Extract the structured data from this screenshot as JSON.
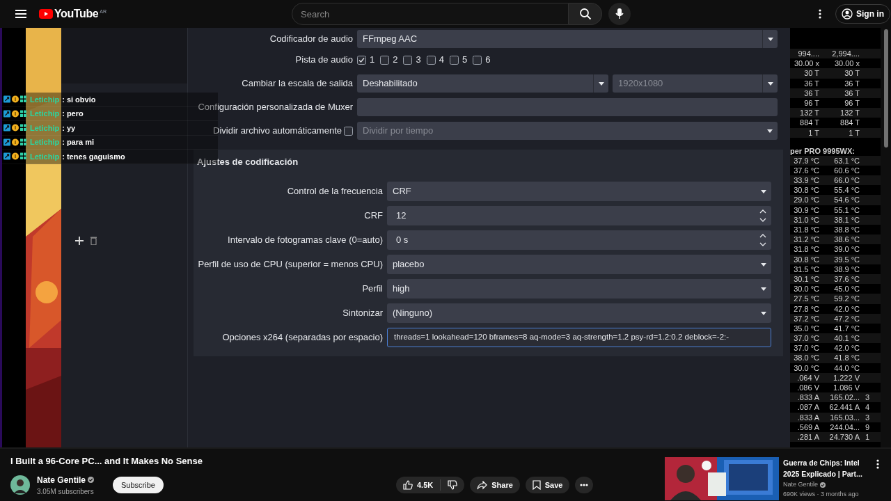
{
  "youtube": {
    "logo": "YouTube",
    "region": "AR",
    "search": {
      "placeholder": "Search"
    },
    "sign_in": "Sign in"
  },
  "video": {
    "chat": [
      {
        "user": "Letichip",
        "message": ": si obvio"
      },
      {
        "user": "Letichip",
        "message": ": pero"
      },
      {
        "user": "Letichip",
        "message": ": yy"
      },
      {
        "user": "Letichip",
        "message": ": para mi"
      },
      {
        "user": "Letichip",
        "message": ": tenes gaguismo"
      }
    ],
    "output_settings": [
      {
        "kind": "select",
        "label": "Codificador de audio",
        "value": "FFmpeg AAC"
      },
      {
        "kind": "tracks",
        "label": "Pista de audio",
        "tracks": [
          {
            "label": "1",
            "checked": true
          },
          {
            "label": "2",
            "checked": false
          },
          {
            "label": "3",
            "checked": false
          },
          {
            "label": "4",
            "checked": false
          },
          {
            "label": "5",
            "checked": false
          },
          {
            "label": "6",
            "checked": false
          }
        ]
      },
      {
        "kind": "dual_select",
        "label": "Cambiar la escala de salida",
        "value": "Deshabilitado",
        "value_2": "1920x1080",
        "disabled_2": true
      },
      {
        "kind": "text",
        "label": "Configuración personalizada de Muxer"
      },
      {
        "kind": "check_select",
        "label": "Dividir archivo automáticamente",
        "checked": false,
        "value": "Dividir por tiempo",
        "disabled": true
      }
    ],
    "encoding": {
      "title": "Ajustes de codificación",
      "rows": [
        {
          "kind": "select",
          "label": "Control de la frecuencia",
          "value": "CRF"
        },
        {
          "kind": "spin",
          "label": "CRF",
          "value": "12"
        },
        {
          "kind": "spin",
          "label": "Intervalo de fotogramas clave (0=auto)",
          "value": "0 s"
        },
        {
          "kind": "select",
          "label": "Perfil de uso de CPU (superior = menos CPU)",
          "value": "placebo"
        },
        {
          "kind": "select",
          "label": "Perfil",
          "value": "high"
        },
        {
          "kind": "select",
          "label": "Sintonizar",
          "value": "(Ninguno)"
        },
        {
          "kind": "text",
          "label": "Opciones x264 (separadas por espacio)",
          "value": "threads=1 lookahead=120 bframes=8 aq-mode=3 aq-strength=1.2 psy-rd=1.2:0.2 deblock=-2:-",
          "focused": true
        }
      ]
    },
    "sensors": [
      {
        "kind": "values",
        "cells": [
          "994....",
          "2,994...."
        ]
      },
      {
        "kind": "values",
        "cells": [
          "30.00 x",
          "30.00 x"
        ]
      },
      {
        "kind": "values",
        "cells": [
          "30 T",
          "30 T"
        ]
      },
      {
        "kind": "values",
        "cells": [
          "36 T",
          "36 T"
        ]
      },
      {
        "kind": "values",
        "cells": [
          "36 T",
          "36 T"
        ]
      },
      {
        "kind": "values",
        "cells": [
          "96 T",
          "96 T"
        ]
      },
      {
        "kind": "values",
        "cells": [
          "132 T",
          "132 T"
        ]
      },
      {
        "kind": "values",
        "cells": [
          "884 T",
          "884 T"
        ]
      },
      {
        "kind": "values",
        "cells": [
          "1 T",
          "1 T"
        ]
      },
      {
        "kind": "header",
        "text": "per PRO 9995WX:"
      },
      {
        "kind": "values",
        "cells": [
          "37.9 °C",
          "63.1 °C"
        ]
      },
      {
        "kind": "values",
        "cells": [
          "37.6 °C",
          "60.6 °C"
        ]
      },
      {
        "kind": "values",
        "cells": [
          "33.9 °C",
          "66.0 °C"
        ]
      },
      {
        "kind": "values",
        "cells": [
          "30.8 °C",
          "55.4 °C"
        ]
      },
      {
        "kind": "values",
        "cells": [
          "29.0 °C",
          "54.6 °C"
        ]
      },
      {
        "kind": "values",
        "cells": [
          "30.9 °C",
          "55.1 °C"
        ]
      },
      {
        "kind": "values",
        "cells": [
          "31.0 °C",
          "38.1 °C"
        ]
      },
      {
        "kind": "values",
        "cells": [
          "31.8 °C",
          "38.8 °C"
        ]
      },
      {
        "kind": "values",
        "cells": [
          "31.2 °C",
          "38.6 °C"
        ]
      },
      {
        "kind": "values",
        "cells": [
          "31.8 °C",
          "39.0 °C"
        ]
      },
      {
        "kind": "values",
        "cells": [
          "30.8 °C",
          "39.5 °C"
        ]
      },
      {
        "kind": "values",
        "cells": [
          "31.5 °C",
          "38.9 °C"
        ]
      },
      {
        "kind": "values",
        "cells": [
          "30.1 °C",
          "37.6 °C"
        ]
      },
      {
        "kind": "values",
        "cells": [
          "30.0 °C",
          "45.0 °C"
        ]
      },
      {
        "kind": "values",
        "cells": [
          "27.5 °C",
          "59.2 °C"
        ]
      },
      {
        "kind": "values",
        "cells": [
          "27.8 °C",
          "42.0 °C"
        ]
      },
      {
        "kind": "values",
        "cells": [
          "37.2 °C",
          "47.2 °C"
        ]
      },
      {
        "kind": "values",
        "cells": [
          "35.0 °C",
          "41.7 °C"
        ]
      },
      {
        "kind": "values",
        "cells": [
          "37.0 °C",
          "40.1 °C"
        ]
      },
      {
        "kind": "values",
        "cells": [
          "37.0 °C",
          "42.0 °C"
        ]
      },
      {
        "kind": "values",
        "cells": [
          "38.0 °C",
          "41.8 °C"
        ]
      },
      {
        "kind": "values",
        "cells": [
          "30.0 °C",
          "44.0 °C"
        ]
      },
      {
        "kind": "values",
        "cells": [
          ".064 V",
          "1.222 V"
        ]
      },
      {
        "kind": "values",
        "cells": [
          ".086 V",
          "1.086 V"
        ]
      },
      {
        "kind": "values",
        "cells": [
          ".833 A",
          "165.02...",
          "3"
        ]
      },
      {
        "kind": "values",
        "cells": [
          ".087 A",
          "62.441 A",
          "4"
        ]
      },
      {
        "kind": "values",
        "cells": [
          ".833 A",
          "165.03...",
          "3"
        ]
      },
      {
        "kind": "values",
        "cells": [
          ".569 A",
          "244.04...",
          "9"
        ]
      },
      {
        "kind": "values",
        "cells": [
          ".281 A",
          "24.730 A",
          "1"
        ]
      }
    ]
  },
  "video_info": {
    "title": "I Built a 96-Core PC... and It Makes No Sense",
    "channel": "Nate Gentile",
    "subscribers": "3.05M subscribers",
    "subscribe": "Subscribe",
    "likes": "4.5K",
    "share": "Share",
    "save": "Save"
  },
  "recommended": {
    "title": "Guerra de Chips: Intel 2025 Explicado | Part...",
    "channel": "Nate Gentile",
    "meta": "690K views · 3 months ago"
  }
}
